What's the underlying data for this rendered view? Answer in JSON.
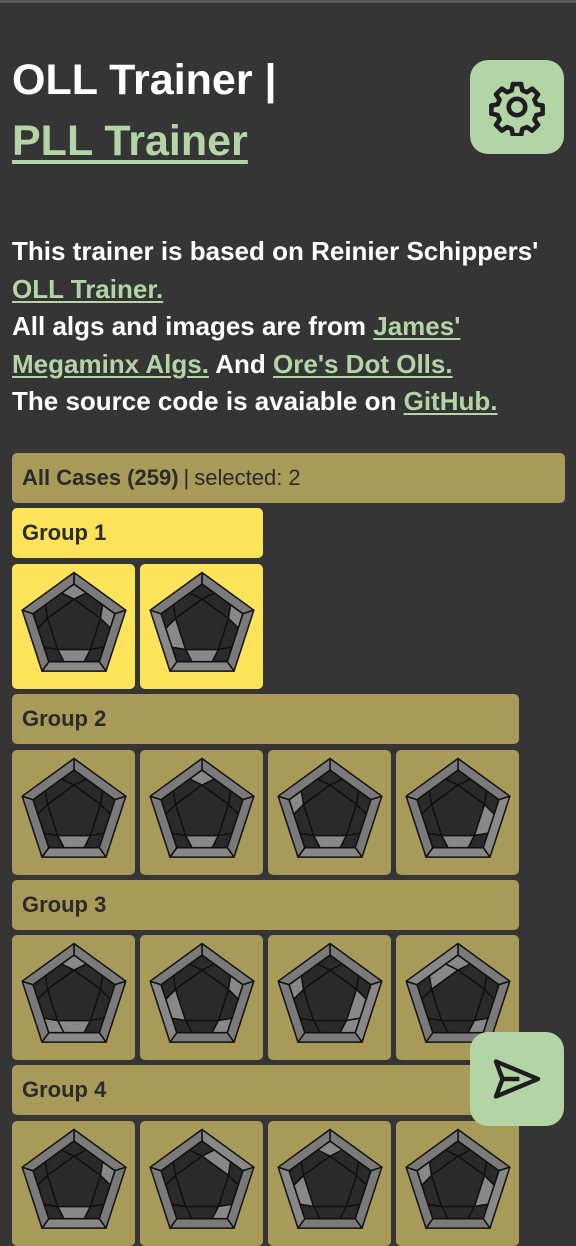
{
  "header": {
    "title_prefix": "OLL Trainer |",
    "title_link": "PLL Trainer",
    "settings_icon": "gear-icon"
  },
  "intro": {
    "line1_text": "This trainer is based on Reinier Schippers'",
    "line1_link": "OLL Trainer.",
    "line2_text": "All algs and images are from",
    "line2_link1": "James' Megaminx Algs.",
    "line2_mid": "And",
    "line2_link2": "Ore's Dot Olls.",
    "line3_text": "The source code is avaiable on",
    "line3_link": "GitHub."
  },
  "cases": {
    "all_label": "All Cases (259)",
    "separator": "|",
    "selected_text": "selected: 2"
  },
  "groups": [
    {
      "label": "Group 1",
      "selected": true
    },
    {
      "label": "Group 2",
      "selected": false
    },
    {
      "label": "Group 3",
      "selected": false
    },
    {
      "label": "Group 4",
      "selected": false
    }
  ],
  "colors": {
    "background": "#353535",
    "accent_green": "#b3d4a5",
    "group_khaki": "#a89b59",
    "group_selected_yellow": "#fde35a",
    "sticker_dark": "#2a2a2a",
    "sticker_light": "#888888"
  },
  "fab": {
    "icon": "send-icon"
  }
}
